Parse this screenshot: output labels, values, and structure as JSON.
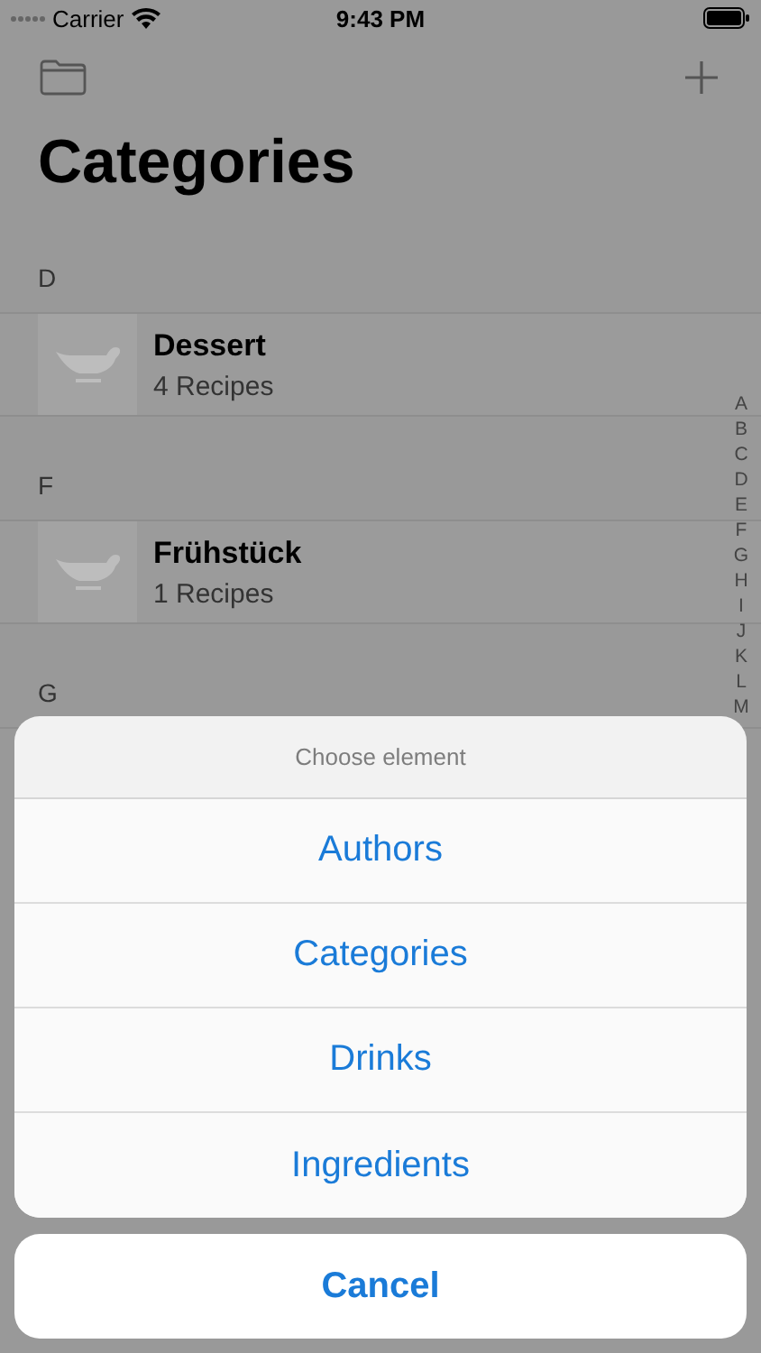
{
  "status_bar": {
    "carrier": "Carrier",
    "time": "9:43 PM"
  },
  "nav": {
    "title": "Categories"
  },
  "sections": [
    {
      "letter": "D",
      "rows": [
        {
          "name": "Dessert",
          "count": "4 Recipes"
        }
      ]
    },
    {
      "letter": "F",
      "rows": [
        {
          "name": "Frühstück",
          "count": "1 Recipes"
        }
      ]
    },
    {
      "letter": "G"
    }
  ],
  "index": [
    "A",
    "B",
    "C",
    "D",
    "E",
    "F",
    "G",
    "H",
    "I",
    "J",
    "K",
    "L",
    "M"
  ],
  "action_sheet": {
    "title": "Choose element",
    "options": [
      "Authors",
      "Categories",
      "Drinks",
      "Ingredients"
    ],
    "cancel": "Cancel"
  }
}
